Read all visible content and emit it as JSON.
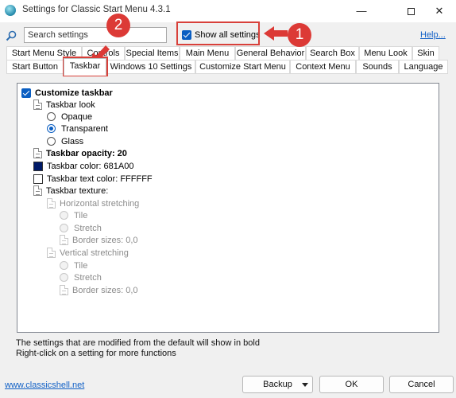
{
  "window": {
    "title": "Settings for Classic Start Menu 4.3.1",
    "min_glyph": "—",
    "close_glyph": "✕"
  },
  "search": {
    "placeholder": "Search settings"
  },
  "show_all": {
    "label": "Show all settings",
    "checked": true
  },
  "help": {
    "label": "Help..."
  },
  "tabs_row1": [
    "Start Menu Style",
    "Controls",
    "Special Items",
    "Main Menu",
    "General Behavior",
    "Search Box",
    "Menu Look",
    "Skin"
  ],
  "tabs_row2": [
    "Start Button",
    "Taskbar",
    "Windows 10 Settings",
    "Customize Start Menu",
    "Context Menu",
    "Sounds",
    "Language"
  ],
  "active_tab": "Taskbar",
  "tree": {
    "customize_taskbar": "Customize taskbar",
    "taskbar_look": "Taskbar look",
    "opaque": "Opaque",
    "transparent": "Transparent",
    "glass": "Glass",
    "opacity": "Taskbar opacity: 20",
    "color": "Taskbar color: 681A00",
    "text_color": "Taskbar text color: FFFFFF",
    "texture": "Taskbar texture:",
    "h_stretch": "Horizontal stretching",
    "h_tile": "Tile",
    "h_stretch_opt": "Stretch",
    "h_border": "Border sizes: 0,0",
    "v_stretch": "Vertical stretching",
    "v_tile": "Tile",
    "v_stretch_opt": "Stretch",
    "v_border": "Border sizes: 0,0"
  },
  "colors": {
    "taskbar_color_swatch": "#001a68",
    "text_color_swatch": "#ffffff",
    "accent": "#0a5ec2",
    "callout": "#dc3a36"
  },
  "hint": {
    "line1": "The settings that are modified from the default will show in bold",
    "line2": "Right-click on a setting for more functions"
  },
  "footer": {
    "link": "www.classicshell.net",
    "backup": "Backup",
    "ok": "OK",
    "cancel": "Cancel"
  },
  "callouts": {
    "one": "1",
    "two": "2"
  }
}
